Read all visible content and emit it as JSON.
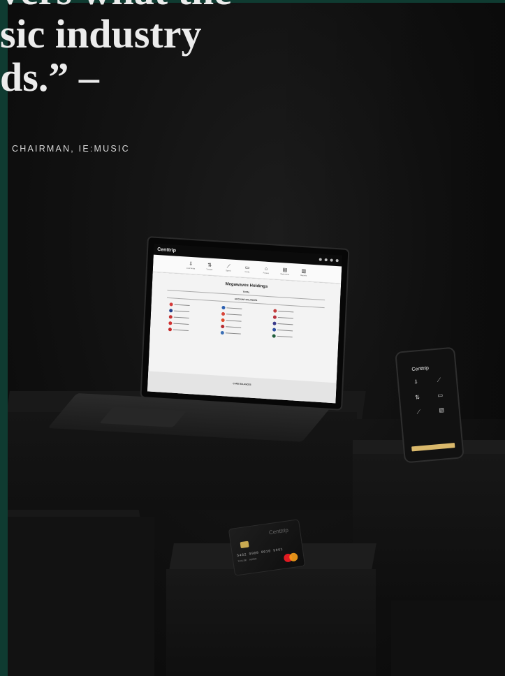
{
  "headline": {
    "line1": "vers what the",
    "line2": "sic industry",
    "line3": "ds.” –"
  },
  "attribution": "CHAIRMAN, IE:MUSIC",
  "laptop_app": {
    "brand": "Centtrip",
    "nav_items": [
      {
        "icon": "download-icon",
        "glyph": "⇩",
        "label": "Load funds"
      },
      {
        "icon": "transfer-icon",
        "glyph": "⇅",
        "label": "Transfer"
      },
      {
        "icon": "trend-icon",
        "glyph": "⟋",
        "label": "Spend"
      },
      {
        "icon": "card-icon",
        "glyph": "▭",
        "label": "Cards"
      },
      {
        "icon": "bank-icon",
        "glyph": "⌂",
        "label": "Payees"
      },
      {
        "icon": "document-icon",
        "glyph": "▤",
        "label": "Statements"
      },
      {
        "icon": "report-icon",
        "glyph": "▥",
        "label": "Reports"
      }
    ],
    "company": "Megawaves Holdings",
    "total_label": "TOTAL",
    "account_balances_label": "ACCOUNT BALANCES",
    "card_balances_label": "CARD BALANCES",
    "balances": [
      {
        "color": "#d43a3a"
      },
      {
        "color": "#2a5fb0"
      },
      {
        "color": "#c23b3b"
      },
      {
        "color": "#233f8a"
      },
      {
        "color": "#d8463a"
      },
      {
        "color": "#b72f3c"
      },
      {
        "color": "#c53030"
      },
      {
        "color": "#e04a2a"
      },
      {
        "color": "#3a3a8a"
      },
      {
        "color": "#d03030"
      },
      {
        "color": "#b52a30"
      },
      {
        "color": "#2d4fa0"
      },
      {
        "color": "#c62828"
      },
      {
        "color": "#3b6fb5"
      },
      {
        "color": "#1f5d3a"
      }
    ]
  },
  "phone_app": {
    "brand": "Centtrip",
    "tiles": [
      {
        "icon": "download-icon",
        "glyph": "⇩"
      },
      {
        "icon": "trend-icon",
        "glyph": "⟋"
      },
      {
        "icon": "transfer-icon",
        "glyph": "⇅"
      },
      {
        "icon": "card-icon",
        "glyph": "▭"
      },
      {
        "icon": "chart-icon",
        "glyph": "⟋"
      },
      {
        "icon": "document-icon",
        "glyph": "▤"
      }
    ]
  },
  "card": {
    "brand": "Centtrip",
    "number": "5462 9900 0010 9961",
    "name": "TAYLOR  ASHER"
  },
  "colors": {
    "accent_green": "#0f3b31",
    "card_gold": "#c8a951"
  }
}
